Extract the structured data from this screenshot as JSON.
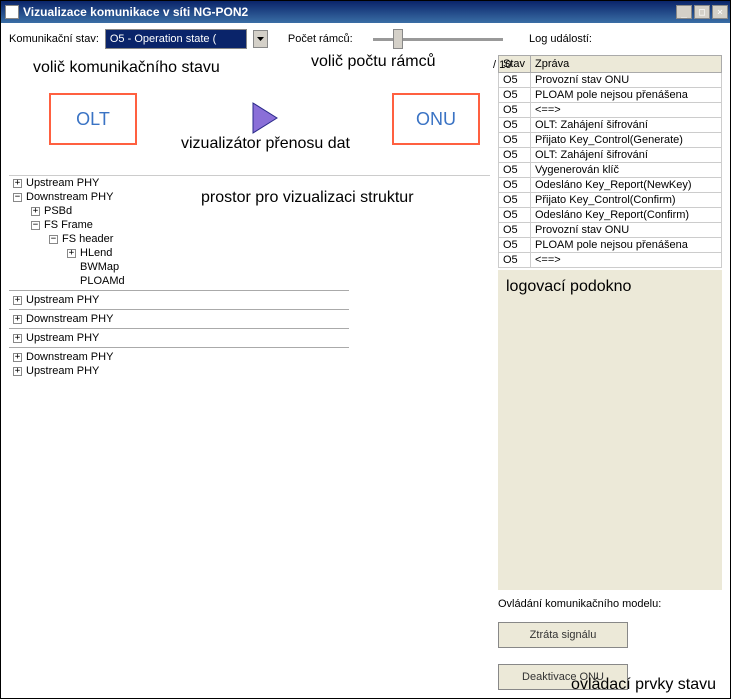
{
  "titlebar": {
    "title": "Vizualizace komunikace v síti NG-PON2"
  },
  "toolbar": {
    "state_label": "Komunikační stav:",
    "state_value": "O5 - Operation state (",
    "frames_label": "Počet rámců:",
    "frames_suffix": " / 10",
    "log_label": "Log událostí:"
  },
  "annotations": {
    "state_selector": "volič komunikačního stavu",
    "frames_selector": "volič počtu rámců",
    "visualizer": "vizualizátor přenosu dat",
    "struct_area": "prostor pro vizualizaci struktur",
    "log_pane": "logovací podokno",
    "controls": "ovládací prvky stavu"
  },
  "nodes": {
    "olt": "OLT",
    "onu": "ONU"
  },
  "tree": [
    {
      "indent": 0,
      "toggle": "+",
      "label": "Upstream PHY"
    },
    {
      "indent": 0,
      "toggle": "-",
      "label": "Downstream PHY"
    },
    {
      "indent": 1,
      "toggle": "+",
      "label": "PSBd"
    },
    {
      "indent": 1,
      "toggle": "-",
      "label": "FS Frame"
    },
    {
      "indent": 2,
      "toggle": "-",
      "label": "FS header"
    },
    {
      "indent": 3,
      "toggle": "+",
      "label": "HLend"
    },
    {
      "indent": 3,
      "toggle": "",
      "label": "BWMap"
    },
    {
      "indent": 3,
      "toggle": "",
      "label": "PLOAMd"
    },
    {
      "rule": true
    },
    {
      "indent": 0,
      "toggle": "+",
      "label": "Upstream PHY"
    },
    {
      "rule": true
    },
    {
      "indent": 0,
      "toggle": "+",
      "label": "Downstream PHY"
    },
    {
      "rule": true
    },
    {
      "indent": 0,
      "toggle": "+",
      "label": "Upstream PHY"
    },
    {
      "rule": true
    },
    {
      "indent": 0,
      "toggle": "+",
      "label": "Downstream PHY"
    },
    {
      "indent": 0,
      "toggle": "+",
      "label": "Upstream PHY"
    }
  ],
  "log": {
    "headers": {
      "state": "Stav",
      "msg": "Zpráva"
    },
    "rows": [
      {
        "state": "O5",
        "msg": "Provozní stav ONU"
      },
      {
        "state": "O5",
        "msg": "PLOAM pole nejsou přenášena"
      },
      {
        "state": "O5",
        "msg": "<==>"
      },
      {
        "state": "O5",
        "msg": "OLT: Zahájení šifrování"
      },
      {
        "state": "O5",
        "msg": "Přijato Key_Control(Generate)"
      },
      {
        "state": "O5",
        "msg": "OLT: Zahájení šifrování"
      },
      {
        "state": "O5",
        "msg": "Vygenerován klíč"
      },
      {
        "state": "O5",
        "msg": "Odesláno Key_Report(NewKey)"
      },
      {
        "state": "O5",
        "msg": "Přijato Key_Control(Confirm)"
      },
      {
        "state": "O5",
        "msg": "Odesláno Key_Report(Confirm)"
      },
      {
        "state": "O5",
        "msg": "Provozní stav ONU"
      },
      {
        "state": "O5",
        "msg": "PLOAM pole nejsou přenášena"
      },
      {
        "state": "O5",
        "msg": "<==>"
      }
    ]
  },
  "controls": {
    "label": "Ovládání komunikačního modelu:",
    "signal_loss": "Ztráta signálu",
    "deactivate": "Deaktivace ONU"
  }
}
